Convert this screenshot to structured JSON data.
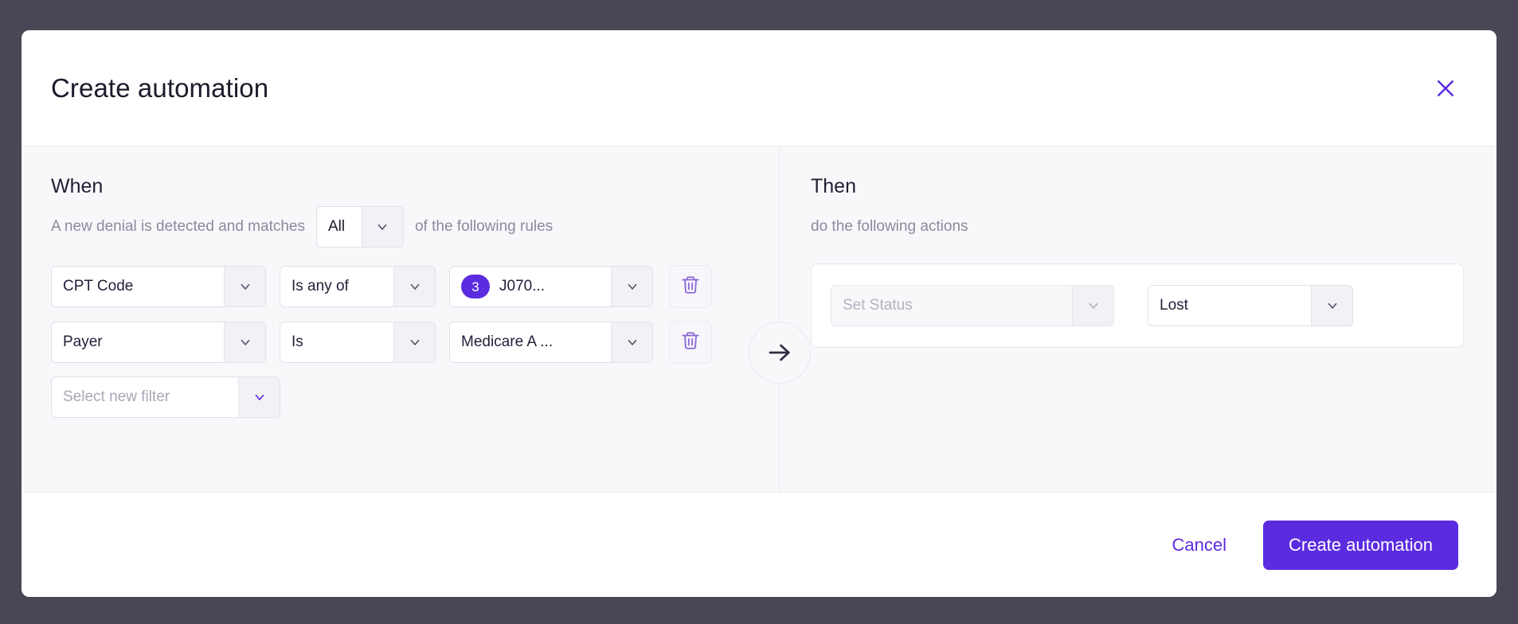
{
  "modal": {
    "title": "Create automation",
    "close_icon": "close-icon"
  },
  "when": {
    "heading": "When",
    "sentence_prefix": "A new denial is detected and matches",
    "match_mode": "All",
    "sentence_suffix": "of the following rules",
    "rules": [
      {
        "field": "CPT Code",
        "operator": "Is any of",
        "value": "J070...",
        "value_count": "3",
        "delete_icon": "trash-icon"
      },
      {
        "field": "Payer",
        "operator": "Is",
        "value": "Medicare A ...",
        "delete_icon": "trash-icon"
      }
    ],
    "new_filter_placeholder": "Select new filter"
  },
  "connector": {
    "icon": "arrow-right-icon"
  },
  "then": {
    "heading": "Then",
    "subtitle": "do the following actions",
    "action": {
      "type_placeholder": "Set Status",
      "value": "Lost"
    }
  },
  "footer": {
    "cancel_label": "Cancel",
    "submit_label": "Create automation"
  },
  "colors": {
    "accent": "#5b2be0",
    "overlay": "#4a4655",
    "panel_bg": "#f8f8fb",
    "text": "#1c1b2b",
    "muted": "#8b8a9c"
  }
}
